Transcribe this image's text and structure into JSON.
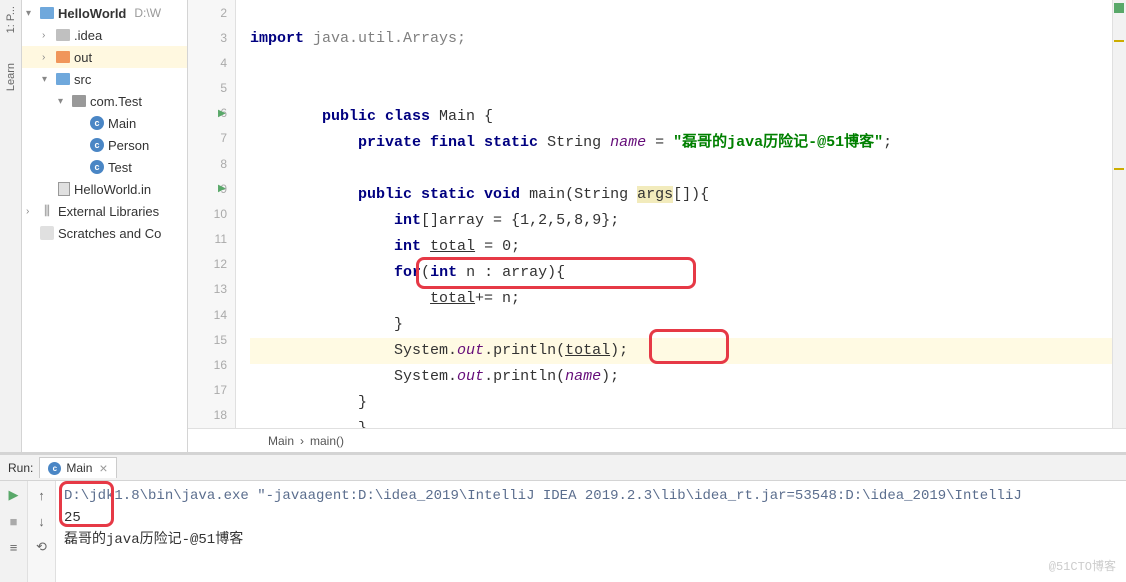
{
  "leftRail": {
    "label1": "1: P...",
    "label2": "Learn"
  },
  "tree": {
    "root": {
      "name": "HelloWorld",
      "path": "D:\\W"
    },
    "idea": ".idea",
    "out": "out",
    "src": "src",
    "pkg": "com.Test",
    "classMain": "Main",
    "classPerson": "Person",
    "classTest": "Test",
    "iml": "HelloWorld.in",
    "extlib": "External Libraries",
    "scratch": "Scratches and Co"
  },
  "gutter": [
    "2",
    "3",
    "4",
    "5",
    "6",
    "7",
    "8",
    "9",
    "10",
    "11",
    "12",
    "13",
    "14",
    "15",
    "16",
    "17",
    "18"
  ],
  "breadcrumb": {
    "a": "Main",
    "b": "main()"
  },
  "code": {
    "l3_import": "import",
    "l3_pkg": " java.util.Arrays;",
    "l6a": "public class ",
    "l6b": "Main {",
    "l7a": "private final static ",
    "l7b": "String ",
    "l7c": "name",
    "l7d": " = ",
    "l7e": "\"磊哥的java历险记-@51博客\"",
    "l7f": ";",
    "l9a": "public static void ",
    "l9b": "main(String ",
    "l9c": "args",
    "l9d": "[]){",
    "l10a": "int",
    "l10b": "[]array = {",
    "l10c": "1",
    "l10d": ",",
    "l10e": "2",
    "l10f": ",",
    "l10g": "5",
    "l10h": ",",
    "l10i": "8",
    "l10j": ",",
    "l10k": "9",
    "l10l": "};",
    "l11a": "int ",
    "l11b": "total",
    "l11c": " = ",
    "l11d": "0",
    "l11e": ";",
    "l12a": "for",
    "l12b": "(",
    "l12c": "int ",
    "l12d": "n : array){",
    "l13a": "total",
    "l13b": "+= n;",
    "l14": "}",
    "l15a": "System.",
    "l15b": "out",
    "l15c": ".println(",
    "l15d": "total",
    "l15e": ");",
    "l16a": "System.",
    "l16b": "out",
    "l16c": ".println(",
    "l16d": "name",
    "l16e": ");",
    "l17": "}",
    "l18": "}"
  },
  "run": {
    "label": "Run:",
    "tab": "Main",
    "cmd": "D:\\jdk1.8\\bin\\java.exe \"-javaagent:D:\\idea_2019\\IntelliJ IDEA 2019.2.3\\lib\\idea_rt.jar=53548:D:\\idea_2019\\IntelliJ",
    "out1": "25",
    "out2": "磊哥的java历险记-@51博客"
  },
  "watermark": "@51CTO博客"
}
